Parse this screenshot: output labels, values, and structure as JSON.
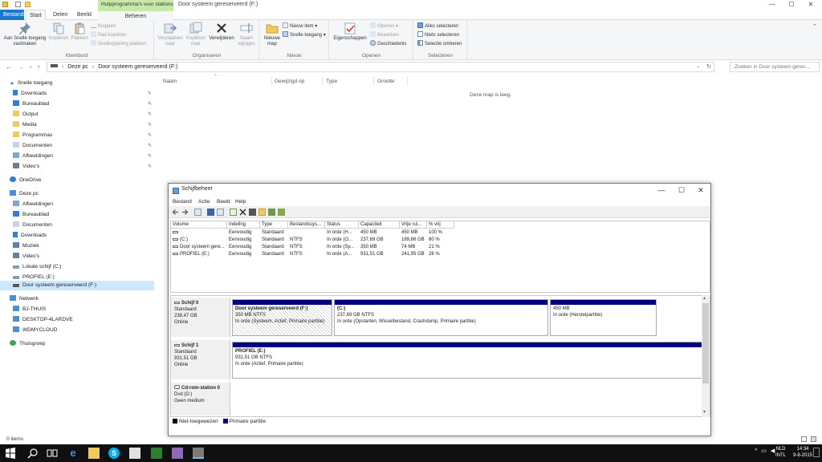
{
  "window": {
    "title": "Door systeem gereserveerd (F:)",
    "context_tab_title": "Hulpprogramma's voor stations",
    "min": "—",
    "max": "☐",
    "close": "✕"
  },
  "ribbon_tabs": {
    "bestand": "Bestand",
    "start": "Start",
    "delen": "Delen",
    "beeld": "Beeld",
    "beheren": "Beheren"
  },
  "ribbon": {
    "klembord": {
      "label": "Klembord",
      "pin": "Aan Snelle toegang vastmaken",
      "copy": "Kopiëren",
      "paste": "Plakken",
      "cut": "Knippen",
      "copy_path": "Pad kopiëren",
      "paste_shortcut": "Snelkoppeling plakken"
    },
    "organiseren": {
      "label": "Organiseren",
      "move_to": "Verplaatsen naar",
      "copy_to": "Kopiëren naar",
      "delete": "Verwijderen",
      "rename": "Naam wijzigen"
    },
    "nieuw": {
      "label": "Nieuw",
      "new_folder": "Nieuwe map",
      "new_item": "Nieuw item",
      "easy_access": "Snelle toegang"
    },
    "openen": {
      "label": "Openen",
      "properties": "Eigenschappen",
      "open": "Openen",
      "edit": "Bewerken",
      "history": "Geschiedenis"
    },
    "selecteren": {
      "label": "Selecteren",
      "select_all": "Alles selecteren",
      "select_none": "Niets selecteren",
      "invert": "Selectie omkeren"
    }
  },
  "address": {
    "back": "←",
    "forward": "→",
    "recent": "⌄",
    "up": "↑",
    "crumbs": [
      "Deze pc",
      "›",
      "Door systeem gereserveerd (F:)"
    ],
    "dropdown": "⌄",
    "refresh": "↻",
    "search_placeholder": "Zoeken in Door systeem geres..."
  },
  "navpane": {
    "quick_access": "Snelle toegang",
    "quick_items": [
      "Downloads",
      "Bureaublad",
      "Output",
      "Media",
      "Programmas",
      "Documenten",
      "Afbeeldingen",
      "Video's"
    ],
    "onedrive": "OneDrive",
    "this_pc": "Deze pc",
    "pc_items": [
      "Afbeeldingen",
      "Bureaublad",
      "Documenten",
      "Downloads",
      "Muziek",
      "Video's",
      "Lokale schijf (C:)",
      "PROFIEL (E:)",
      "Door systeem gereserveerd (F:)"
    ],
    "network": "Netwerk",
    "network_items": [
      "BJ-THUIS",
      "DESKTOP-4LARDVE",
      "WDMYCLOUD"
    ],
    "homegroup": "Thuisgroep"
  },
  "filelist": {
    "columns": [
      "Naam",
      "Gewijzigd op",
      "Type",
      "Grootte"
    ],
    "empty_message": "Deze map is leeg."
  },
  "status": {
    "count": "0 items"
  },
  "diskmgmt": {
    "title": "Schijfbeheer",
    "min": "—",
    "max": "☐",
    "close": "✕",
    "menu": [
      "Bestand",
      "Actie",
      "Beeld",
      "Help"
    ],
    "columns": [
      "Volume",
      "Indeling",
      "Type",
      "Bestandssys...",
      "Status",
      "Capaciteit",
      "Vrije rui...",
      "% vrij"
    ],
    "rows": [
      [
        "",
        "Eenvoudig",
        "Standaard",
        "",
        "In orde (H...",
        "450 MB",
        "450 MB",
        "100 %"
      ],
      [
        "(C:)",
        "Eenvoudig",
        "Standaard",
        "NTFS",
        "In orde (O...",
        "237,69 GB",
        "189,66 GB",
        "80 %"
      ],
      [
        "Door systeem gere...",
        "Eenvoudig",
        "Standaard",
        "NTFS",
        "In orde (Sy...",
        "350 MB",
        "74 MB",
        "21 %"
      ],
      [
        "PROFIEL (E:)",
        "Eenvoudig",
        "Standaard",
        "NTFS",
        "In orde (A...",
        "931,51 GB",
        "241,95 GB",
        "26 %"
      ]
    ],
    "disks": [
      {
        "name": "Schijf 0",
        "kind": "Standaard",
        "size": "238,47 GB",
        "state": "Online",
        "partitions": [
          {
            "title": "Door systeem gereserveerd  (F:)",
            "line2": "350 MB NTFS",
            "line3": "In orde (Systeem, Actief, Primaire partitie)"
          },
          {
            "title": "(C:)",
            "line2": "237,69 GB NTFS",
            "line3": "In orde (Opstarten, Wisselbestand, Crashdump, Primaire partitie)"
          },
          {
            "title": "",
            "line2": "450 MB",
            "line3": "In orde (Herstelpartitie)"
          }
        ]
      },
      {
        "name": "Schijf 1",
        "kind": "Standaard",
        "size": "931,51 GB",
        "state": "Online",
        "partitions": [
          {
            "title": "PROFIEL  (E:)",
            "line2": "931,51 GB NTFS",
            "line3": "In orde (Actief, Primaire partitie)"
          }
        ]
      },
      {
        "name": "Cd-rom-station 0",
        "kind": "Dvd (D:)",
        "size": "",
        "state": "Geen medium"
      }
    ],
    "legend": {
      "unallocated": "Niet-toegewezen",
      "primary": "Primaire partitie"
    }
  },
  "taskbar": {
    "lang_top": "NLD",
    "lang_bottom": "INTL",
    "time": "14:34",
    "date": "9-8-2015"
  },
  "colors": {
    "accent": "#1979ca",
    "partition_bar": "#000080",
    "selected": "#cce8ff",
    "context_tab": "#c7e9a8"
  }
}
